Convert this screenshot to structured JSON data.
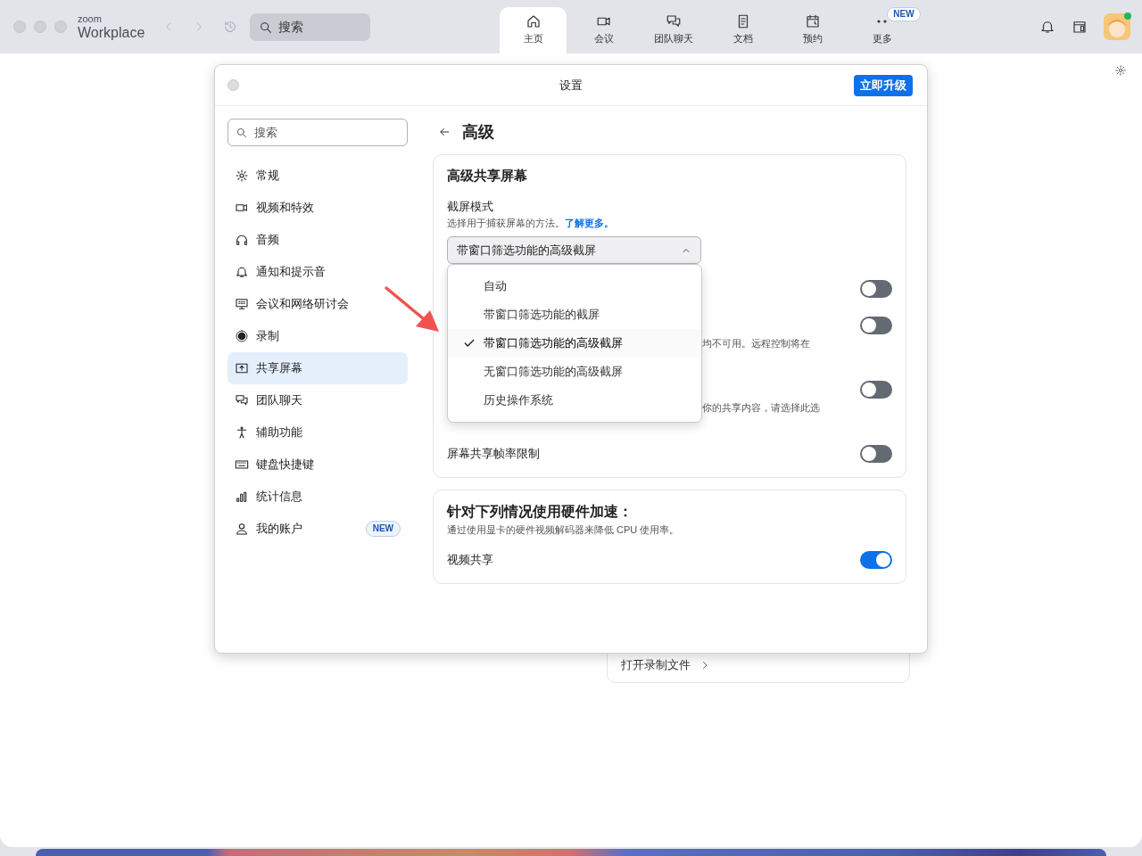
{
  "app": {
    "logo_small": "zoom",
    "logo": "Workplace",
    "search": {
      "placeholder": "搜索"
    }
  },
  "nav_tabs": [
    {
      "label": "主页",
      "selected": true
    },
    {
      "label": "会议",
      "selected": false
    },
    {
      "label": "团队聊天",
      "selected": false
    },
    {
      "label": "文档",
      "selected": false
    },
    {
      "label": "预约",
      "selected": false
    },
    {
      "label": "更多",
      "selected": false,
      "badge": "NEW"
    }
  ],
  "dialog": {
    "title": "设置",
    "upgrade_button": "立即升级",
    "search": {
      "placeholder": "搜索"
    },
    "sidebar": [
      {
        "label": "常规",
        "selected": false
      },
      {
        "label": "视频和特效",
        "selected": false
      },
      {
        "label": "音频",
        "selected": false
      },
      {
        "label": "通知和提示音",
        "selected": false
      },
      {
        "label": "会议和网络研讨会",
        "selected": false
      },
      {
        "label": "录制",
        "selected": false
      },
      {
        "label": "共享屏幕",
        "selected": true
      },
      {
        "label": "团队聊天",
        "selected": false
      },
      {
        "label": "辅助功能",
        "selected": false
      },
      {
        "label": "键盘快捷键",
        "selected": false
      },
      {
        "label": "统计信息",
        "selected": false
      },
      {
        "label": "我的账户",
        "selected": false,
        "badge": "NEW"
      }
    ],
    "page_title": "高级",
    "screen_section": {
      "title": "高级共享屏幕",
      "field_label": "截屏模式",
      "field_hint": "选择用于捕获屏幕的方法。",
      "link": "了解更多。",
      "select": {
        "value": "带窗口筛选功能的高级截屏",
        "expanded": true,
        "options": [
          {
            "label": "自动",
            "selected": false
          },
          {
            "label": "带窗口筛选功能的截屏",
            "selected": false
          },
          {
            "label": "带窗口筛选功能的高级截屏",
            "selected": true
          },
          {
            "label": "无窗口筛选功能的高级截屏",
            "selected": false
          },
          {
            "label": "历史操作系统",
            "selected": false
          }
        ]
      },
      "toggles": [
        {
          "on": false
        },
        {
          "desc": "均不可用。远程控制将在",
          "on": false
        },
        {
          "desc": "你的共享内容，请选择此选",
          "on": false
        },
        {
          "label": "屏幕共享帧率限制",
          "on": false
        }
      ]
    },
    "hw_section": {
      "title": "针对下列情况使用硬件加速：",
      "hint": "通过使用显卡的硬件视频解码器来降低 CPU 使用率。",
      "toggles": [
        {
          "label": "视频共享",
          "on": true
        }
      ]
    }
  },
  "background_card": {
    "label": "打开录制文件"
  }
}
